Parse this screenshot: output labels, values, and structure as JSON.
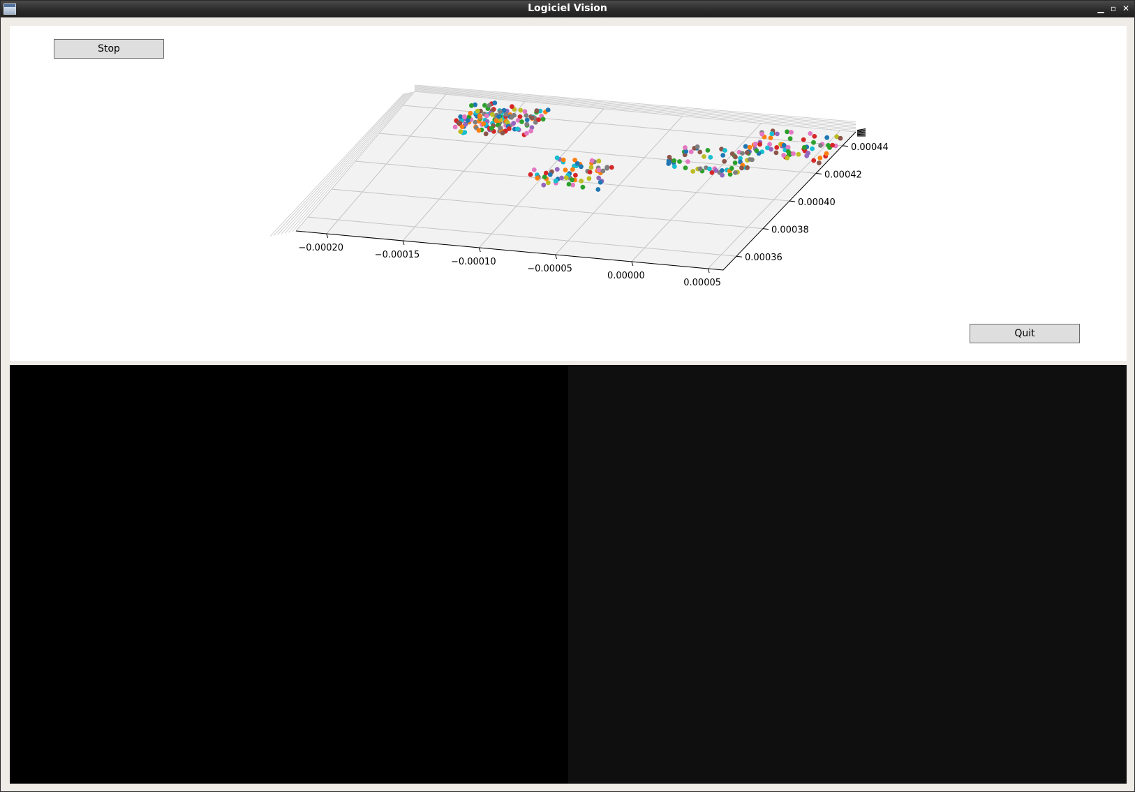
{
  "window": {
    "title": "Logiciel Vision"
  },
  "controls": {
    "stop_label": "Stop",
    "quit_label": "Quit"
  },
  "window_buttons": {
    "minimize": "minimize-icon",
    "maximize": "maximize-icon",
    "close": "close-icon"
  },
  "chart_data": {
    "type": "scatter",
    "projection": "3d",
    "title": "",
    "xlabel": "",
    "ylabel": "",
    "zlabel": "",
    "x_ticks": [
      "−0.00020",
      "−0.00015",
      "−0.00010",
      "−0.00005",
      "0.00000",
      "0.00005"
    ],
    "y_ticks": [
      "0.00036",
      "0.00038",
      "0.00040",
      "0.00042",
      "0.00044"
    ],
    "xlim": [
      -0.00022,
      6e-05
    ],
    "ylim": [
      0.00035,
      0.00045
    ],
    "grid": true,
    "legend": "none",
    "palette": [
      "#1f77b4",
      "#ff7f0e",
      "#2ca02c",
      "#d62728",
      "#9467bd",
      "#8c564b",
      "#e377c2",
      "#7f7f7f",
      "#bcbd22",
      "#17becf"
    ],
    "clusters": [
      {
        "x": -0.000155,
        "y": 0.000436,
        "count": 150
      },
      {
        "x": -8.5e-05,
        "y": 0.000405,
        "count": 60
      },
      {
        "x": -1e-05,
        "y": 0.000423,
        "count": 60
      },
      {
        "x": 3e-05,
        "y": 0.000437,
        "count": 70
      }
    ]
  }
}
